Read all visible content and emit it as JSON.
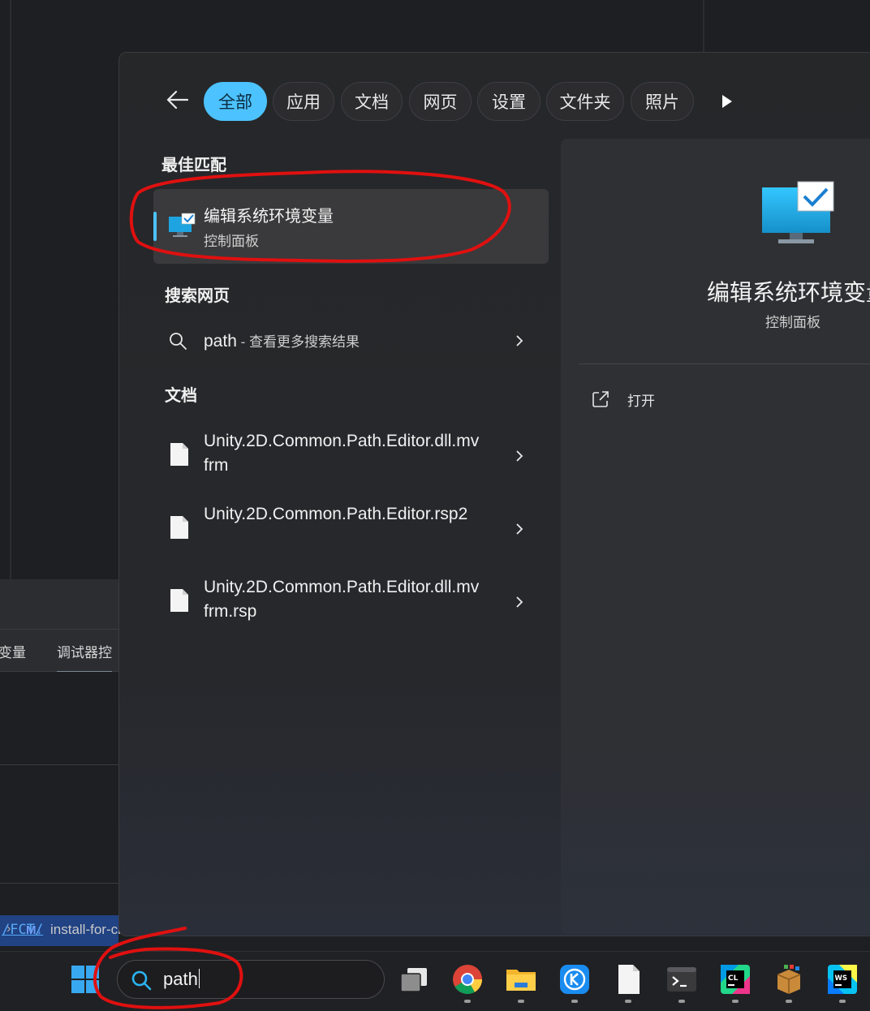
{
  "background": {
    "panel_tabs": [
      "变量",
      "调试器控"
    ],
    "path_link": "/FCT/",
    "file_item": {
      "badge": "M↓",
      "name": "install-for-cli.md"
    }
  },
  "search": {
    "filters": [
      "全部",
      "应用",
      "文档",
      "网页",
      "设置",
      "文件夹",
      "照片"
    ],
    "active_filter": "全部",
    "best_match": {
      "section_title": "最佳匹配",
      "title": "编辑系统环境变量",
      "subtitle": "控制面板"
    },
    "web": {
      "section_title": "搜索网页",
      "query": "path",
      "suffix": " - 查看更多搜索结果"
    },
    "docs": {
      "section_title": "文档",
      "items": [
        "Unity.2D.Common.Path.Editor.dll.mvfrm",
        "Unity.2D.Common.Path.Editor.rsp2",
        "Unity.2D.Common.Path.Editor.dll.mvfrm.rsp"
      ]
    },
    "preview": {
      "title": "编辑系统环境变量",
      "subtitle": "控制面板",
      "action_open": "打开"
    }
  },
  "taskbar": {
    "search_value": "path",
    "apps": [
      "task-view",
      "chrome",
      "file-explorer",
      "kugou",
      "notepad",
      "terminal",
      "clion",
      "package",
      "webstorm"
    ]
  },
  "colors": {
    "accent": "#4cc2ff",
    "annotation": "#e01010"
  }
}
